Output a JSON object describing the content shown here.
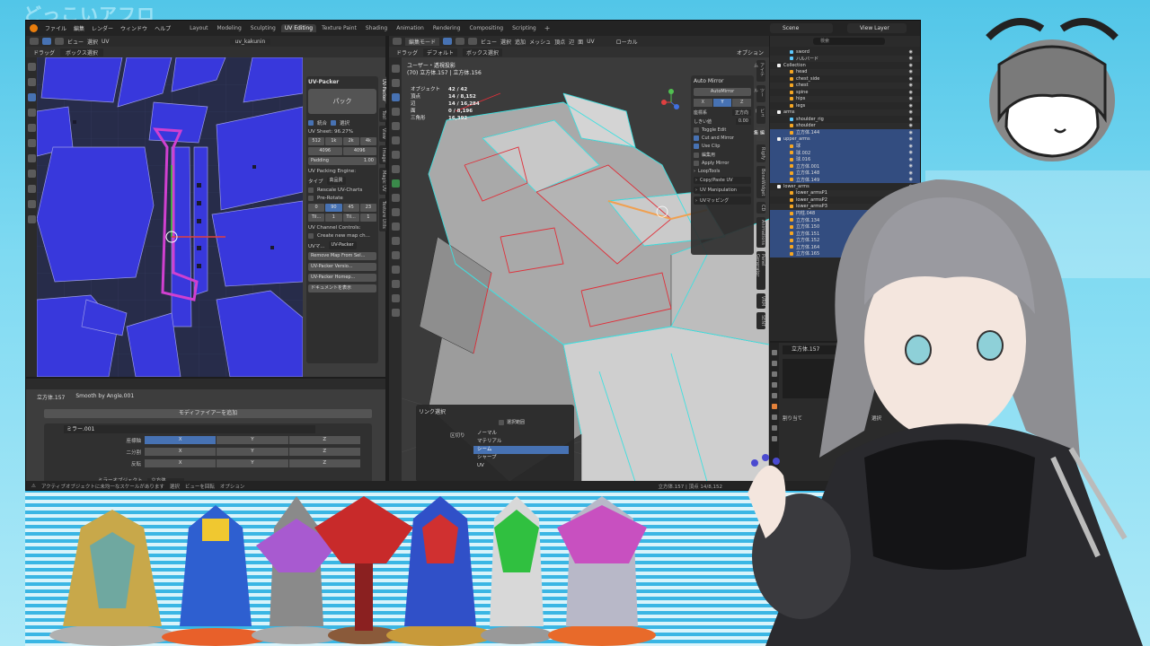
{
  "stream_title": "どっこいアフロ",
  "blender": {
    "menus": [
      "ファイル",
      "編集",
      "レンダー",
      "ウィンドウ",
      "ヘルプ"
    ],
    "workspaces": [
      "Layout",
      "Modeling",
      "Sculpting",
      "UV Editing",
      "Texture Paint",
      "Shading",
      "Animation",
      "Rendering",
      "Compositing",
      "Scripting"
    ],
    "active_workspace": "UV Editing",
    "scene": "Scene",
    "view_layer": "View Layer"
  },
  "uv_editor": {
    "header_view": "ビュー",
    "header_select": "選択",
    "header_image": "UV",
    "image_name": "uv_kakunin",
    "drag_label": "ドラッグ",
    "box_select": "ボックス選択"
  },
  "uv_packer": {
    "title": "UV-Packer",
    "pack_button": "パック",
    "check_merge": "統合",
    "check_select": "選択",
    "uv_sheet": "UV Sheet:",
    "uv_sheet_pct": "96.27%",
    "sizes": [
      "512",
      "1k",
      "2k",
      "4k"
    ],
    "size_w": "4096",
    "size_h": "4096",
    "padding_label": "Padding",
    "padding_value": "1.00",
    "engine_label": "UV Packing Engine:",
    "type_label": "タイプ",
    "type_value": "高品質",
    "rescale": "Rescale UV-Charts",
    "prerotate": "Pre-Rotate",
    "rot_values": [
      "0",
      "90",
      "45",
      "23"
    ],
    "tile_values": [
      "Til...",
      "1",
      "Til...",
      "1"
    ],
    "channel_controls": "UV Channel Controls:",
    "create_map": "Create new map ch...",
    "uv_map_label": "UVマ...",
    "uv_map_value": "UV-Packer",
    "remove_map": "Remove Map From Sel...",
    "version": "UV-Packer Versio...",
    "homepage": "UV-Packer Homep...",
    "docs": "ドキュメントを表示"
  },
  "uv_vtabs": [
    "UV-Packer",
    "Tool",
    "View",
    "Image",
    "Magic UV",
    "Texture Utils"
  ],
  "modifier_editor": {
    "object_name": "立方体.157",
    "modifier": "Smooth by Angle.001",
    "add_modifier": "モディファイアーを追加",
    "mirror_name": "ミラー.001",
    "axis_label": "座標軸",
    "bisect_label": "二分割",
    "flip_label": "反転",
    "axes": [
      "X",
      "Y",
      "Z"
    ],
    "mirror_object_label": "ミラーオブジェクト",
    "mirror_object_value": "立方体"
  },
  "statusbar": {
    "text": "アクティブオブジェクトに未均一なスケールがあります",
    "hint1": "選択",
    "hint2": "ビューを回転",
    "hint3": "オプション",
    "right_info": "立方体.157 | 頂点 14/8,152"
  },
  "viewport": {
    "mode": "編集モード",
    "menus": [
      "ビュー",
      "選択",
      "追加",
      "メッシュ",
      "頂点",
      "辺",
      "面",
      "UV"
    ],
    "transform": "ローカル",
    "drag_label": "ドラッグ",
    "box_select": "ボックス選択",
    "default_label": "デフォルト",
    "options": "オプション",
    "view_title": "ユーザー・透視投影",
    "object_line": "(70) 立方体.157 | 立方体.156",
    "stats": [
      {
        "label": "オブジェクト",
        "value": "42 / 42"
      },
      {
        "label": "頂点",
        "value": "14 / 8,152"
      },
      {
        "label": "辺",
        "value": "14 / 16,284"
      },
      {
        "label": "面",
        "value": "0 / 8,196"
      },
      {
        "label": "三角形",
        "value": "16,392"
      }
    ]
  },
  "auto_mirror": {
    "title": "Auto Mirror",
    "button": "AutoMirror",
    "axes": [
      "X",
      "Y",
      "Z"
    ],
    "orientation_label": "座標系",
    "orientation_value": "正方向",
    "threshold_label": "しきい値",
    "threshold_value": "0.00",
    "toggle_edit": "Toggle Edit",
    "cut_mirror": "Cut and Mirror",
    "use_clip": "Use Clip",
    "edit_mode": "編集用",
    "apply_mirror": "Apply Mirror",
    "looptools": "LoopTools",
    "copy_paste_uv": "Copy/Paste UV",
    "uv_manipulation": "UV Manipulation",
    "uv_mapping": "UVマッピング"
  },
  "link_popup": {
    "title": "リンク選択",
    "delimit_label": "区切り",
    "check_label": "選択範囲",
    "options": [
      "ノーマル",
      "マテリアル",
      "シーム",
      "シャープ",
      "UV"
    ],
    "selected": "シーム"
  },
  "outliner": {
    "search_placeholder": "検索",
    "rows": [
      {
        "name": "sword",
        "type": "bone",
        "selected": false
      },
      {
        "name": "ハルバード",
        "type": "bone",
        "selected": false
      },
      {
        "name": "Collection",
        "type": "col",
        "selected": false
      },
      {
        "name": "head",
        "type": "mesh",
        "selected": false
      },
      {
        "name": "chest_side",
        "type": "mesh",
        "selected": false
      },
      {
        "name": "chest",
        "type": "mesh",
        "selected": false
      },
      {
        "name": "spine",
        "type": "mesh",
        "selected": false
      },
      {
        "name": "hips",
        "type": "mesh",
        "selected": false
      },
      {
        "name": "legs",
        "type": "mesh",
        "selected": false
      },
      {
        "name": "arms",
        "type": "col",
        "selected": false
      },
      {
        "name": "shoulder_rig",
        "type": "bone",
        "selected": false
      },
      {
        "name": "shoulder",
        "type": "mesh",
        "selected": false
      },
      {
        "name": "立方体.144",
        "type": "mesh",
        "selected": true
      },
      {
        "name": "upper_arms",
        "type": "col",
        "selected": true
      },
      {
        "name": "球",
        "type": "mesh",
        "selected": true
      },
      {
        "name": "球.002",
        "type": "mesh",
        "selected": true
      },
      {
        "name": "球.016",
        "type": "mesh",
        "selected": true
      },
      {
        "name": "立方体.001",
        "type": "mesh",
        "selected": true
      },
      {
        "name": "立方体.148",
        "type": "mesh",
        "selected": true
      },
      {
        "name": "立方体.149",
        "type": "mesh",
        "selected": true
      },
      {
        "name": "lower_arms",
        "type": "col",
        "selected": false
      },
      {
        "name": "lower_armsP1",
        "type": "mesh",
        "selected": false
      },
      {
        "name": "lower_armsP2",
        "type": "mesh",
        "selected": false
      },
      {
        "name": "lower_armsP3",
        "type": "mesh",
        "selected": false
      },
      {
        "name": "円柱.048",
        "type": "mesh",
        "selected": true
      },
      {
        "name": "立方体.134",
        "type": "mesh",
        "selected": true
      },
      {
        "name": "立方体.150",
        "type": "mesh",
        "selected": true
      },
      {
        "name": "立方体.151",
        "type": "mesh",
        "selected": true
      },
      {
        "name": "立方体.152",
        "type": "mesh",
        "selected": true
      },
      {
        "name": "立方体.164",
        "type": "mesh",
        "selected": true
      },
      {
        "name": "立方体.165",
        "type": "mesh",
        "selected": true
      }
    ]
  },
  "outliner_vtabs": [
    "アイテム",
    "ツール",
    "ビュー",
    "編集",
    "Rigify",
    "BoneWidget",
    "CD",
    "Animations",
    "Panel Generator",
    "VRM",
    "SENT"
  ],
  "properties": {
    "object_name": "立方体.157",
    "assign_label": "割り当て",
    "select_label": "選択"
  },
  "colors": {
    "blender_bg": "#1d1d1d",
    "accent_blue": "#4772b3",
    "uv_bg": "#272c4a",
    "uv_island": "#3c3ce0",
    "seam_red": "#e0303a",
    "edge_cyan": "#3fe0e0"
  }
}
